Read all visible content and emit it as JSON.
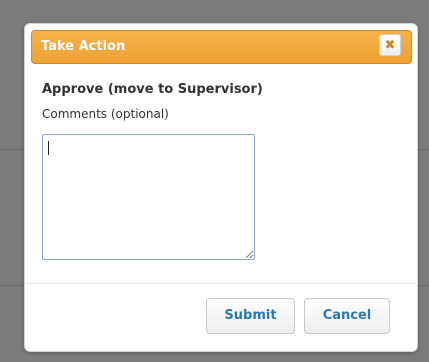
{
  "dialog": {
    "title": "Take Action",
    "close_icon": "close-icon",
    "close_glyph": "✖",
    "action_label": "Approve (move to Supervisor)",
    "comments_label": "Comments (optional)",
    "comments_value": "",
    "submit_label": "Submit",
    "cancel_label": "Cancel"
  },
  "colors": {
    "title_bar": "#eea232",
    "title_text": "#ffffff",
    "close_icon": "#d88320",
    "button_text": "#2b78b8",
    "input_border": "#8ea8d8",
    "backdrop": "#7b7b7b"
  }
}
